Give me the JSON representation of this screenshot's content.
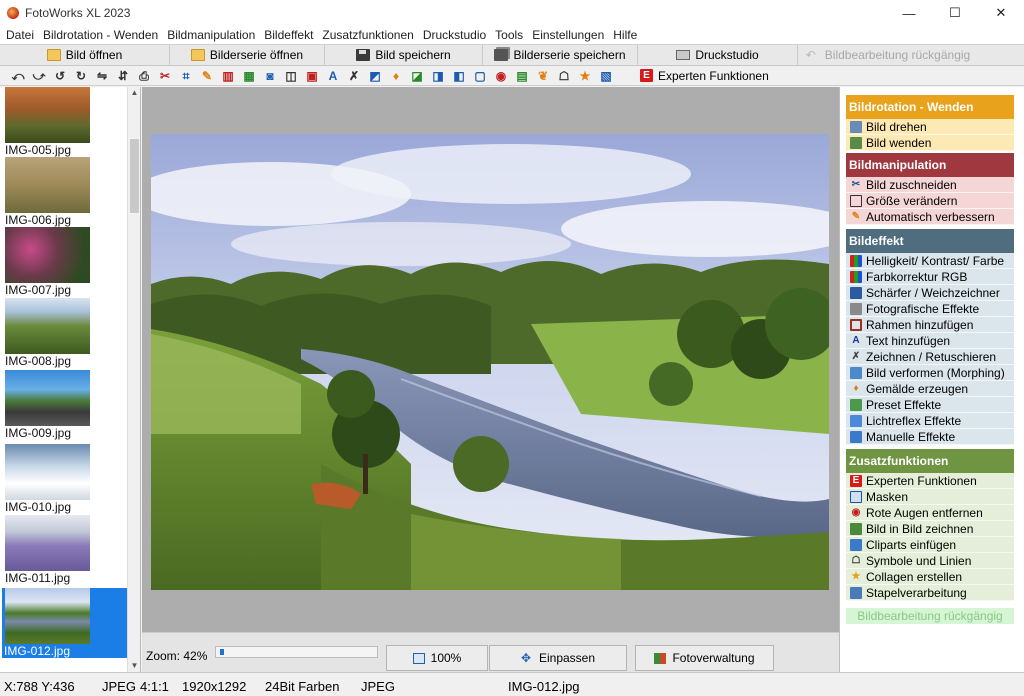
{
  "window": {
    "title": "FotoWorks XL 2023",
    "controls": [
      "—",
      "☐",
      "✕"
    ]
  },
  "menu": [
    "Datei",
    "Bildrotation - Wenden",
    "Bildmanipulation",
    "Bildeffekt",
    "Zusatzfunktionen",
    "Druckstudio",
    "Tools",
    "Einstellungen",
    "Hilfe"
  ],
  "toolbar": {
    "open": "Bild öffnen",
    "open_series": "Bilderserie öffnen",
    "save": "Bild speichern",
    "save_series": "Bilderserie speichern",
    "print_studio": "Druckstudio",
    "undo": "Bildbearbeitung rückgängig"
  },
  "icon_toolbar": {
    "expert": "Experten Funktionen"
  },
  "thumbnails": [
    {
      "label": "IMG-005.jpg",
      "selected": false
    },
    {
      "label": "IMG-006.jpg",
      "selected": false
    },
    {
      "label": "IMG-007.jpg",
      "selected": false
    },
    {
      "label": "IMG-008.jpg",
      "selected": false
    },
    {
      "label": "IMG-009.jpg",
      "selected": false
    },
    {
      "label": "IMG-010.jpg",
      "selected": false
    },
    {
      "label": "IMG-011.jpg",
      "selected": false
    },
    {
      "label": "IMG-012.jpg",
      "selected": true
    }
  ],
  "bottom": {
    "zoom_label": "Zoom: 42%",
    "zoom_value": 0.42,
    "btn_100": "100%",
    "btn_fit": "Einpassen",
    "btn_manager": "Fotoverwaltung"
  },
  "sidebar": {
    "sections": [
      {
        "title": "Bildrotation - Wenden",
        "head_color": "#e8a21c",
        "item_bg": "#fde9b3",
        "items": [
          "Bild drehen",
          "Bild wenden"
        ]
      },
      {
        "title": "Bildmanipulation",
        "head_color": "#a03840",
        "item_bg": "#f5d6d6",
        "items": [
          "Bild zuschneiden",
          "Größe verändern",
          "Automatisch verbessern"
        ]
      },
      {
        "title": "Bildeffekt",
        "head_color": "#4f6d7f",
        "item_bg": "#dbe5ec",
        "items": [
          "Helligkeit/ Kontrast/ Farbe",
          "Farbkorrektur RGB",
          "Schärfer / Weichzeichner",
          "Fotografische Effekte",
          "Rahmen hinzufügen",
          "Text hinzufügen",
          "Zeichnen / Retuschieren",
          "Bild verformen (Morphing)",
          "Gemälde erzeugen",
          "Preset Effekte",
          "Lichtreflex Effekte",
          "Manuelle Effekte"
        ]
      },
      {
        "title": "Zusatzfunktionen",
        "head_color": "#6f9543",
        "item_bg": "#e4eed8",
        "items": [
          "Experten Funktionen",
          "Masken",
          "Rote Augen entfernen",
          "Bild in Bild zeichnen",
          "Cliparts einfügen",
          "Symbole und Linien",
          "Collagen erstellen",
          "Stapelverarbeitung"
        ]
      }
    ],
    "undo": "Bildbearbeitung rückgängig"
  },
  "status": {
    "coords": "X:788 Y:436",
    "format": "JPEG",
    "ratio": "4:1:1",
    "size": "1920x1292",
    "depth": "24Bit Farben",
    "format2": "JPEG",
    "file": "IMG-012.jpg"
  }
}
